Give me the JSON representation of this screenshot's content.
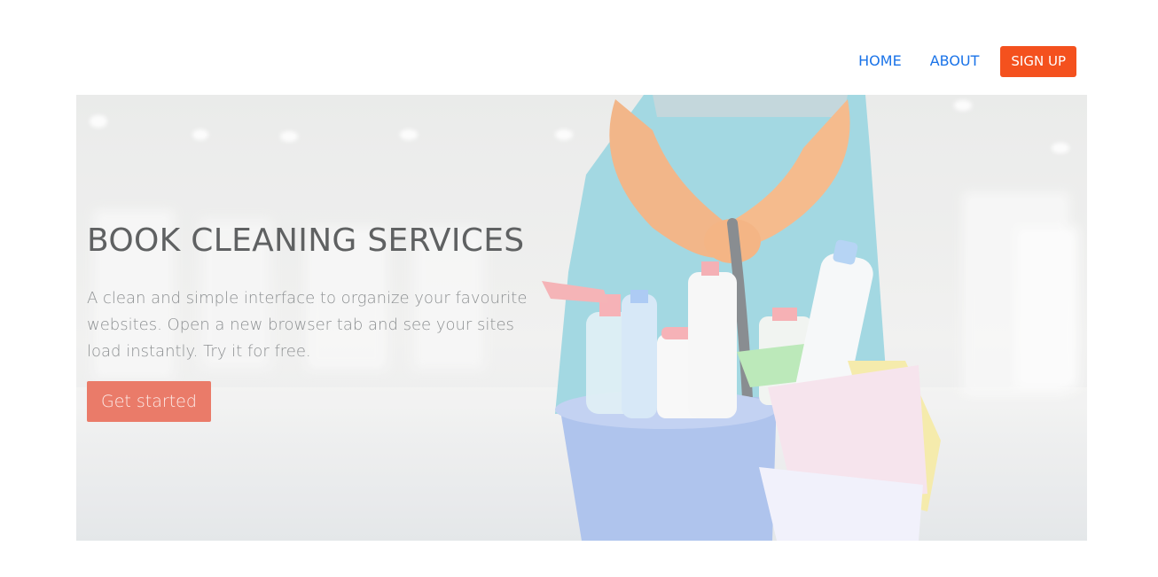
{
  "nav": {
    "home_label": "HOME",
    "about_label": "ABOUT",
    "signup_label": "SIGN UP"
  },
  "hero": {
    "title": "BOOK CLEANING SERVICES",
    "description": "A clean and simple interface to organize your favourite websites. Open a new browser tab and see your sites load instantly. Try it for free.",
    "cta_label": "Get started"
  },
  "colors": {
    "nav_link": "#1a73e8",
    "signup_bg": "#f4511e",
    "cta_bg": "#e96e5a",
    "title": "#5f6162",
    "description": "#8d9092"
  },
  "image": {
    "subject": "cleaner-holding-bucket-of-supplies",
    "icon": "hero-photo"
  }
}
